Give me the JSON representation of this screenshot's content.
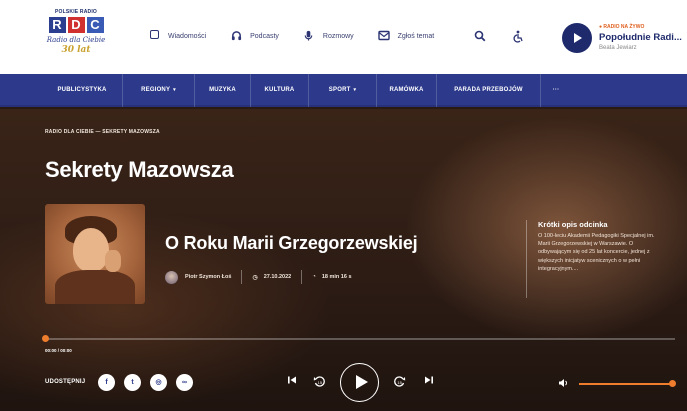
{
  "brand": {
    "logo_top": "POLSKIE RADIO",
    "letters": [
      "R",
      "D",
      "C"
    ],
    "script": "Radio dla Ciebie",
    "years": "30 lat",
    "colors": {
      "navy": "#1e2a6b",
      "red": "#d03030",
      "blue": "#3a5bb5",
      "gold": "#c9a230"
    }
  },
  "topnav": {
    "items": [
      {
        "label": "Wiadomości",
        "icon": "newspaper-icon"
      },
      {
        "label": "Podcasty",
        "icon": "headphones-icon"
      },
      {
        "label": "Rozmowy",
        "icon": "microphone-icon"
      },
      {
        "label": "Zgłoś temat",
        "icon": "envelope-icon"
      }
    ],
    "search_icon": "search-icon",
    "accessibility_icon": "accessibility-icon"
  },
  "now_playing": {
    "live_label": "RADIO NA ŻYWO",
    "title": "Popołudnie Radi...",
    "host": "Beata Jewiarz"
  },
  "main_nav": {
    "items": [
      {
        "label": "PUBLICYSTYKA",
        "has_dropdown": false
      },
      {
        "label": "REGIONY",
        "has_dropdown": true
      },
      {
        "label": "MUZYKA",
        "has_dropdown": false
      },
      {
        "label": "KULTURA",
        "has_dropdown": false
      },
      {
        "label": "SPORT",
        "has_dropdown": true
      },
      {
        "label": "RAMÓWKA",
        "has_dropdown": false
      },
      {
        "label": "PARADA PRZEBOJÓW",
        "has_dropdown": false
      },
      {
        "label": "···",
        "has_dropdown": false
      }
    ],
    "color": "#2d3a8c"
  },
  "hero": {
    "breadcrumb": "RADIO DLA CIEBIE — SEKRETY MAZOWSZA",
    "title": "Sekrety Mazowsza"
  },
  "episode": {
    "title": "O Roku Marii Grzegorzewskiej",
    "author": "Piotr Szymon Łoś",
    "date": "27.10.2022",
    "duration": "18 min 16 s",
    "description_heading": "Krótki opis odcinka",
    "description": "O 100-leciu Akademii Pedagogiki Specjalnej im. Marii Grzegorzewskiej w Warszawie. O odbywającym się od 25 lat koncercie, jednej z większych inicjatyw scenicznych o w pełni integracyjnym...."
  },
  "player": {
    "time": "00:00 / 00:00",
    "progress": 0,
    "volume": 1.0,
    "share_label": "UDOSTĘPNIJ",
    "share_buttons": [
      {
        "name": "facebook",
        "glyph": "f"
      },
      {
        "name": "twitter",
        "glyph": "t"
      },
      {
        "name": "instagram",
        "glyph": "◎"
      },
      {
        "name": "link",
        "glyph": "∞"
      }
    ],
    "accent": "#ef7d2e"
  }
}
